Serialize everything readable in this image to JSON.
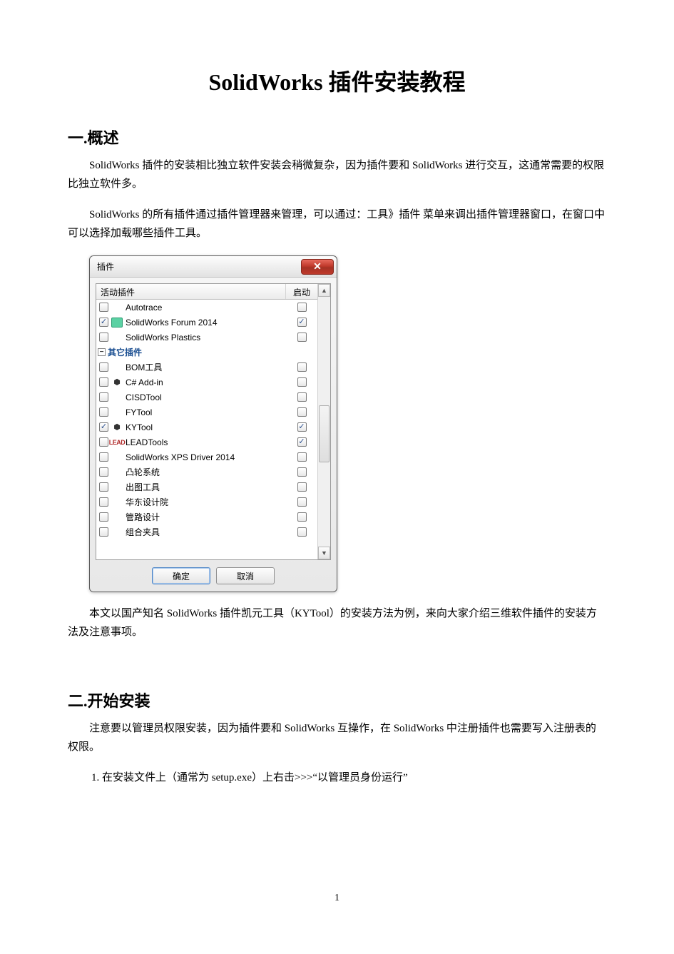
{
  "title": "SolidWorks 插件安装教程",
  "section1": {
    "heading": "一.概述",
    "para1": "SolidWorks 插件的安装相比独立软件安装会稍微复杂，因为插件要和 SolidWorks 进行交互，这通常需要的权限比独立软件多。",
    "para2": "SolidWorks 的所有插件通过插件管理器来管理，可以通过：工具》插件  菜单来调出插件管理器窗口，在窗口中可以选择加载哪些插件工具。",
    "para3": "本文以国产知名 SolidWorks 插件凯元工具（KYTool）的安装方法为例，来向大家介绍三维软件插件的安装方法及注意事项。"
  },
  "section2": {
    "heading": "二.开始安装",
    "para1": "注意要以管理员权限安装，因为插件要和 SolidWorks 互操作，在 SolidWorks 中注册插件也需要写入注册表的权限。",
    "step1": "1.  在安装文件上（通常为 setup.exe）上右击>>>“以管理员身份运行”"
  },
  "dialog": {
    "title": "插件",
    "close_glyph": "✕",
    "header_active": "活动插件",
    "header_start": "启动",
    "section_other": "其它插件",
    "expander_glyph": "−",
    "rows_top": [
      {
        "label": "Autotrace",
        "active": false,
        "start": false,
        "icon": ""
      },
      {
        "label": "SolidWorks Forum 2014",
        "active": true,
        "start": true,
        "icon": "forum"
      },
      {
        "label": "SolidWorks Plastics",
        "active": false,
        "start": false,
        "icon": ""
      }
    ],
    "rows_other": [
      {
        "label": "BOM工具",
        "active": false,
        "start": false,
        "icon": ""
      },
      {
        "label": "C# Add-in",
        "active": false,
        "start": false,
        "icon": "cube"
      },
      {
        "label": "CISDTool",
        "active": false,
        "start": false,
        "icon": ""
      },
      {
        "label": "FYTool",
        "active": false,
        "start": false,
        "icon": ""
      },
      {
        "label": "KYTool",
        "active": true,
        "start": true,
        "icon": "cube"
      },
      {
        "label": "LEADTools",
        "active": false,
        "start": true,
        "icon": "lead"
      },
      {
        "label": "SolidWorks XPS Driver 2014",
        "active": false,
        "start": false,
        "icon": ""
      },
      {
        "label": "凸轮系统",
        "active": false,
        "start": false,
        "icon": ""
      },
      {
        "label": "出图工具",
        "active": false,
        "start": false,
        "icon": ""
      },
      {
        "label": "华东设计院",
        "active": false,
        "start": false,
        "icon": ""
      },
      {
        "label": "管路设计",
        "active": false,
        "start": false,
        "icon": ""
      },
      {
        "label": "组合夹具",
        "active": false,
        "start": false,
        "icon": ""
      }
    ],
    "ok_label": "确定",
    "cancel_label": "取消",
    "scroll_up": "▲",
    "scroll_down": "▼"
  },
  "page_number": "1"
}
